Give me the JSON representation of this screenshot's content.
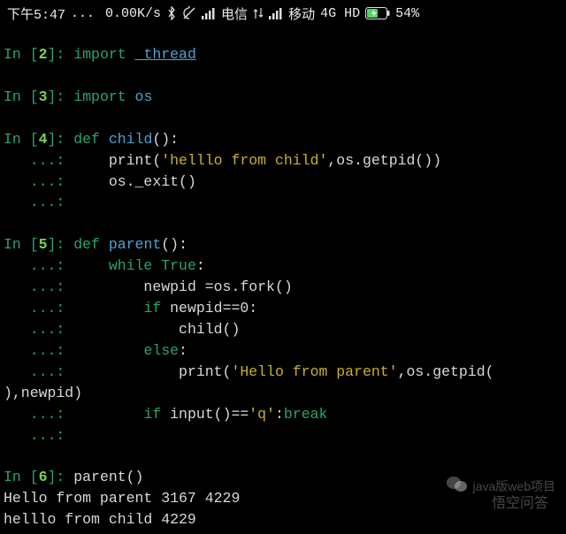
{
  "status": {
    "time": "下午5:47",
    "dots": "...",
    "speed": "0.00K/s",
    "carrier1": "电信",
    "carrier2": "移动",
    "network": "4G HD",
    "battery_pct": "54%"
  },
  "cells": [
    {
      "prompt": "In [",
      "num": "2",
      "prompt_end": "]: ",
      "segments": [
        {
          "cls": "kw",
          "text": "import "
        },
        {
          "cls": "mod",
          "text": "_thread",
          "underline": true
        }
      ]
    },
    {
      "blank": true
    },
    {
      "prompt": "In [",
      "num": "3",
      "prompt_end": "]: ",
      "segments": [
        {
          "cls": "kw",
          "text": "import "
        },
        {
          "cls": "mod",
          "text": "os"
        }
      ]
    },
    {
      "blank": true
    },
    {
      "prompt": "In [",
      "num": "4",
      "prompt_end": "]: ",
      "segments": [
        {
          "cls": "kw",
          "text": "def "
        },
        {
          "cls": "fn",
          "text": "child"
        },
        {
          "cls": "plain",
          "text": "():"
        }
      ]
    },
    {
      "cont": "   ...: ",
      "segments": [
        {
          "cls": "plain",
          "text": "    print("
        },
        {
          "cls": "str",
          "text": "'helllo from child'"
        },
        {
          "cls": "plain",
          "text": ",os.getpid())"
        }
      ]
    },
    {
      "cont": "   ...: ",
      "segments": [
        {
          "cls": "plain",
          "text": "    os._exit()"
        }
      ]
    },
    {
      "cont": "   ...: ",
      "segments": []
    },
    {
      "blank": true
    },
    {
      "prompt": "In [",
      "num": "5",
      "prompt_end": "]: ",
      "segments": [
        {
          "cls": "kw",
          "text": "def "
        },
        {
          "cls": "fn",
          "text": "parent"
        },
        {
          "cls": "plain",
          "text": "():"
        }
      ]
    },
    {
      "cont": "   ...: ",
      "segments": [
        {
          "cls": "plain",
          "text": "    "
        },
        {
          "cls": "kw",
          "text": "while "
        },
        {
          "cls": "kw",
          "text": "True"
        },
        {
          "cls": "plain",
          "text": ":"
        }
      ]
    },
    {
      "cont": "   ...: ",
      "segments": [
        {
          "cls": "plain",
          "text": "        newpid =os.fork()"
        }
      ]
    },
    {
      "cont": "   ...: ",
      "segments": [
        {
          "cls": "plain",
          "text": "        "
        },
        {
          "cls": "kw",
          "text": "if "
        },
        {
          "cls": "plain",
          "text": "newpid=="
        },
        {
          "cls": "plain",
          "text": "0:"
        }
      ]
    },
    {
      "cont": "   ...: ",
      "segments": [
        {
          "cls": "plain",
          "text": "            child()"
        }
      ]
    },
    {
      "cont": "   ...: ",
      "segments": [
        {
          "cls": "plain",
          "text": "        "
        },
        {
          "cls": "kw",
          "text": "else"
        },
        {
          "cls": "plain",
          "text": ":"
        }
      ]
    },
    {
      "cont": "   ...: ",
      "segments": [
        {
          "cls": "plain",
          "text": "            print("
        },
        {
          "cls": "str",
          "text": "'Hello from parent'"
        },
        {
          "cls": "plain",
          "text": ",os.getpid("
        }
      ]
    },
    {
      "raw": true,
      "segments": [
        {
          "cls": "plain",
          "text": "),newpid)"
        }
      ]
    },
    {
      "cont": "   ...: ",
      "segments": [
        {
          "cls": "plain",
          "text": "        "
        },
        {
          "cls": "kw",
          "text": "if "
        },
        {
          "cls": "plain",
          "text": "input()=="
        },
        {
          "cls": "str",
          "text": "'q'"
        },
        {
          "cls": "plain",
          "text": ":"
        },
        {
          "cls": "kw",
          "text": "break"
        }
      ]
    },
    {
      "cont": "   ...: ",
      "segments": []
    },
    {
      "blank": true
    },
    {
      "prompt": "In [",
      "num": "6",
      "prompt_end": "]: ",
      "segments": [
        {
          "cls": "plain",
          "text": "parent()"
        }
      ]
    },
    {
      "output": "Hello from parent 3167 4229"
    },
    {
      "output": "helllo from child 4229"
    }
  ],
  "watermark": {
    "line1": "java版web项目",
    "line2": "悟空问答"
  }
}
